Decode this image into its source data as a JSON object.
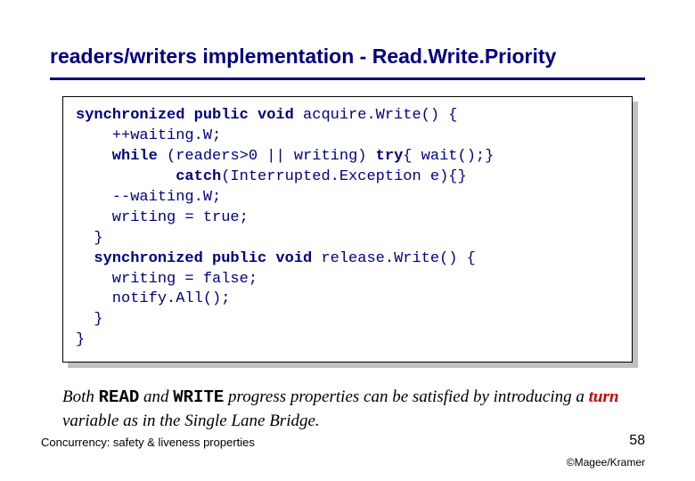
{
  "title": "readers/writers implementation - Read.Write.Priority",
  "code": {
    "l1a": "synchronized public void",
    "l1b": " acquire.Write() {",
    "l2": "    ++waiting.W;",
    "l3a": "    while",
    "l3b": " (readers>0 || writing) ",
    "l3c": "try",
    "l3d": "{ wait();}",
    "l4a": "           catch",
    "l4b": "(Interrupted.Exception e){}",
    "l5": "    --waiting.W;",
    "l6": "    writing = true;",
    "l7": "  }",
    "l8a": "  synchronized public void",
    "l8b": " release.Write() {",
    "l9": "    writing = false;",
    "l10": "    notify.All();",
    "l11": "  }",
    "l12": "}"
  },
  "caption": {
    "t1": "Both ",
    "read": "READ",
    "t2": " and ",
    "write": "WRITE",
    "t3": " progress properties can be satisfied by introducing a ",
    "turn": "turn",
    "t4": " variable as in the Single Lane Bridge."
  },
  "footer": {
    "left": "Concurrency: safety & liveness properties",
    "page": "58",
    "credit": "©Magee/Kramer"
  }
}
